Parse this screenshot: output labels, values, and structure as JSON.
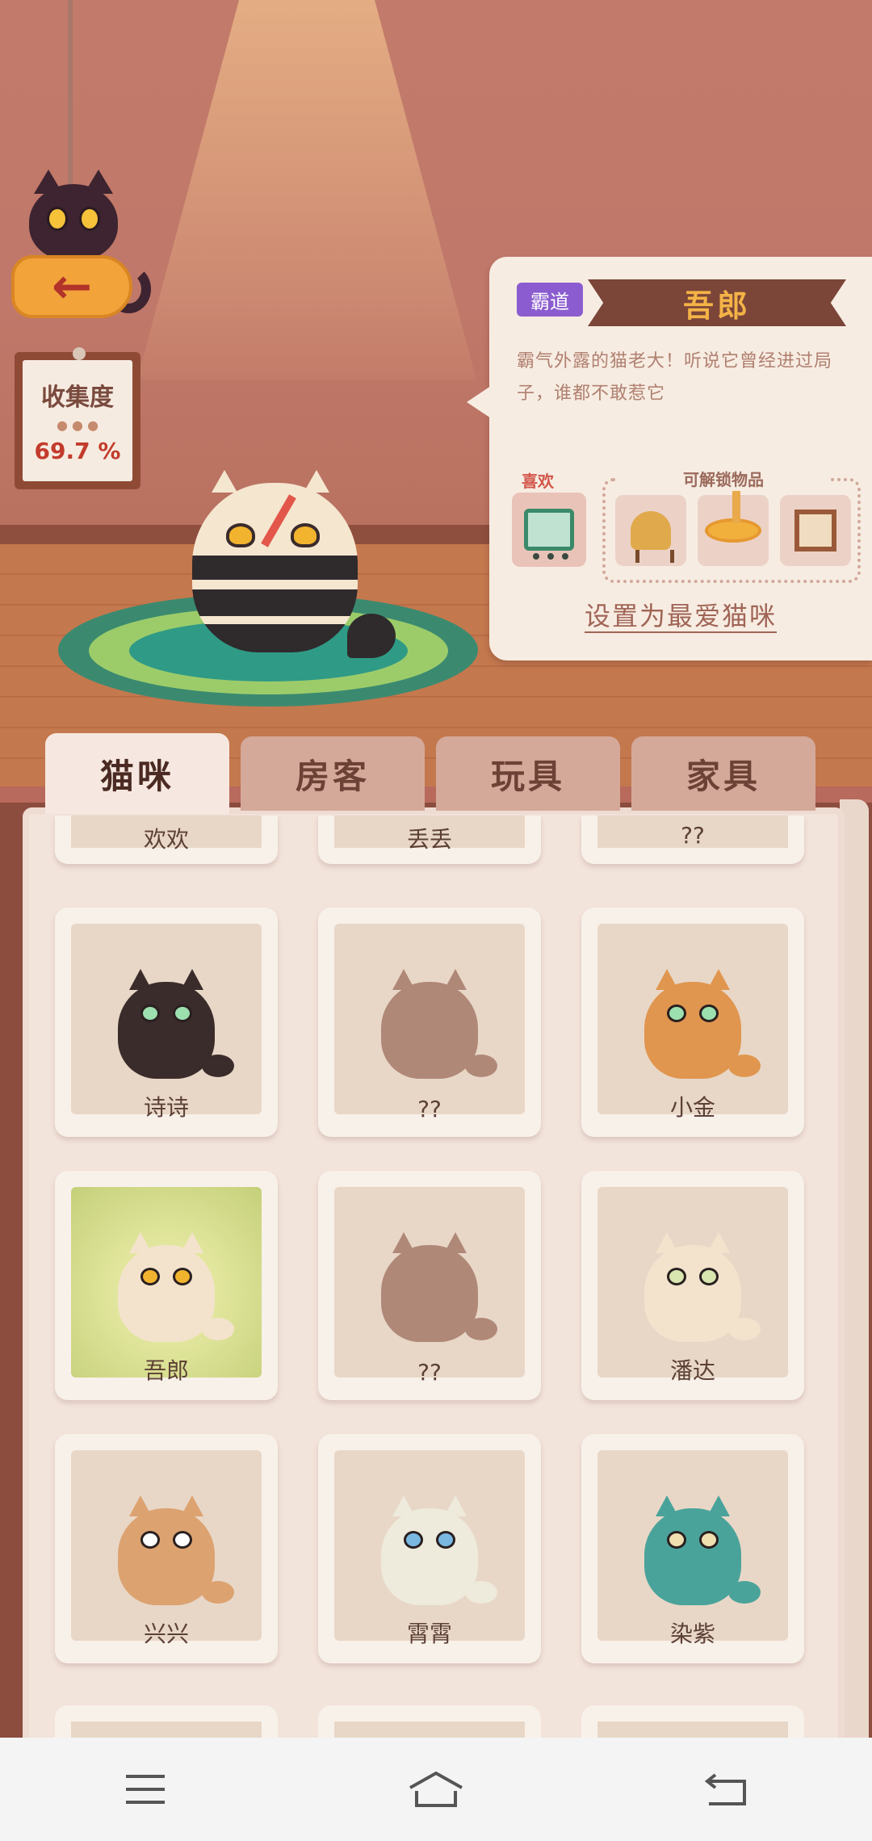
{
  "collection": {
    "title": "收集度",
    "value": "69.7 %"
  },
  "info": {
    "tag": "霸道",
    "name": "吾郎",
    "description": "霸气外露的猫老大！听说它曾经进过局子，谁都不敢惹它",
    "likes_label": "喜欢",
    "unlock_label": "可解锁物品",
    "set_favorite": "设置为最爱猫咪"
  },
  "tabs": [
    "猫咪",
    "房客",
    "玩具",
    "家具"
  ],
  "active_tab": 0,
  "cats_top_row": [
    "欢欢",
    "丢丢",
    "??"
  ],
  "cats": [
    {
      "name": "诗诗",
      "known": true,
      "body": "#3a2c2a",
      "eye": "#9de0b0"
    },
    {
      "name": "??",
      "known": false,
      "body": "#b08878",
      "eye": "#b08878"
    },
    {
      "name": "小金",
      "known": true,
      "body": "#e0964f",
      "eye": "#9de0b0"
    },
    {
      "name": "吾郎",
      "known": true,
      "selected": true,
      "body": "#f3e3cc",
      "eye": "#f2b32e"
    },
    {
      "name": "??",
      "known": false,
      "body": "#b08878",
      "eye": "#b08878"
    },
    {
      "name": "潘达",
      "known": true,
      "body": "#f3e3cc",
      "eye": "#d8e6b0"
    },
    {
      "name": "兴兴",
      "known": true,
      "body": "#dca270",
      "eye": "#ffffff"
    },
    {
      "name": "霄霄",
      "known": true,
      "body": "#eeeadc",
      "eye": "#7ab8e2"
    },
    {
      "name": "染紫",
      "known": true,
      "body": "#4aa39a",
      "eye": "#f0e0b0"
    }
  ],
  "colors": {
    "accent_purple": "#8b5ccf",
    "ribbon": "#7b4538",
    "ribbon_text": "#f4b347"
  },
  "icons": {
    "back": "fish-arrow-icon",
    "nav": [
      "menu-icon",
      "home-icon",
      "back-icon"
    ]
  }
}
